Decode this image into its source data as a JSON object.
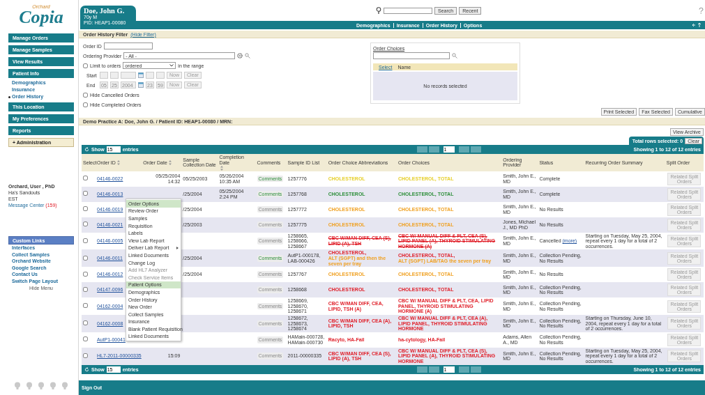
{
  "sidebar": {
    "logo": {
      "caption": "Orchard",
      "name": "Copia"
    },
    "nav": [
      {
        "label": "Manage Orders",
        "kind": "button"
      },
      {
        "label": "Manage Samples",
        "kind": "button"
      },
      {
        "label": "View Results",
        "kind": "button"
      },
      {
        "label": "Patient Info",
        "kind": "button",
        "children": [
          {
            "label": "Demographics",
            "selected": false
          },
          {
            "label": "Insurance",
            "selected": false
          },
          {
            "label": "Order History",
            "selected": true
          }
        ]
      },
      {
        "label": "This Location",
        "kind": "button"
      },
      {
        "label": "My Preferences",
        "kind": "button"
      },
      {
        "label": "Reports",
        "kind": "button"
      },
      {
        "label": "+ Administration",
        "kind": "admin"
      }
    ],
    "user": {
      "name": "Orchard, User , PhD",
      "location": "Ha's Sandouts",
      "timezone": "EST",
      "message_label": "Message Center",
      "message_count": "(159)"
    },
    "custom_links": {
      "title": "Custom Links",
      "items": [
        "Interfaces",
        "Collect Samples",
        "Orchard Website",
        "Google Search",
        "Contact Us",
        "Switch Page Layout"
      ],
      "hide": "Hide Menu"
    }
  },
  "patient": {
    "name": "Doe, John G.",
    "age_sex": "70y M",
    "pid": "PID: HEAP1-00080"
  },
  "search": {
    "search_button": "Search",
    "recent_button": "Recent"
  },
  "nav_links": [
    "Demographics",
    "Insurance",
    "Order History",
    "Options"
  ],
  "filter": {
    "title": "Order History Filter",
    "hide_link": "(Hide Filter)",
    "order_id_label": "Order ID",
    "provider_label": "Ordering Provider",
    "provider_value": "- All -",
    "limit": {
      "label": "Limit to orders",
      "checked": false,
      "value": "ordered",
      "suffix": "in the range"
    },
    "start": {
      "label": "Start",
      "now": "Now",
      "clear": "Clear"
    },
    "end": {
      "label": "End",
      "month": "05",
      "day": "25",
      "year": "2004",
      "hour": "23",
      "minute": "59",
      "now": "Now",
      "clear": "Clear"
    },
    "hide_options": [
      {
        "label": "Hide Cancelled Orders",
        "checked": false
      },
      {
        "label": "Hide Completed Orders",
        "checked": false
      }
    ]
  },
  "order_choices": {
    "title": "Order Choices",
    "columns": [
      "Select",
      "Name"
    ],
    "empty": "No records selected"
  },
  "actions": [
    "Print Selected",
    "Fax Selected",
    "Cumulative"
  ],
  "practice_bar": "Demo Practice A: Doe, John G. / Patient ID: HEAP1-00080 / MRN:",
  "view_archive": "View Archive",
  "selection": {
    "label": "Total rows selected: 0",
    "clear": "Clear"
  },
  "toolbars": [
    {
      "show": "Show",
      "entries_value": "15",
      "entries": "entries",
      "page": "1",
      "info": "Showing 1 to 12 of 12 entries"
    },
    {
      "show": "Show",
      "entries_value": "15",
      "entries": "entries",
      "page": "1",
      "info": "Showing 1 to 12 of 12 entries"
    }
  ],
  "columns": [
    {
      "label": "Select",
      "kind": "plain"
    },
    {
      "label": "Order ID",
      "kind": "sortable"
    },
    {
      "label": "Order Date",
      "kind": "sortable"
    },
    {
      "label": "Sample Collection Date",
      "kind": "plain"
    },
    {
      "label": "Completion Date",
      "kind": "sortable"
    },
    {
      "label": "Comments",
      "kind": "plain"
    },
    {
      "label": "Sample ID List",
      "kind": "plain"
    },
    {
      "label": "Order Choice Abbreviations",
      "kind": "plain"
    },
    {
      "label": "Order Choices",
      "kind": "plain"
    },
    {
      "label": "Ordering Provider",
      "kind": "plain"
    },
    {
      "label": "Status",
      "kind": "plain"
    },
    {
      "label": "Recurring Order Summary",
      "kind": "plain"
    },
    {
      "label": "Split Order",
      "kind": "plain"
    }
  ],
  "rows": [
    {
      "selected": false,
      "id": "04146-0022",
      "order_date": "05/25/2004 14:32",
      "collection_date": "05/25/2003",
      "completion_date": "05/26/2004 10:35 AM",
      "comments": {
        "label": "Comments",
        "has": true
      },
      "sample_ids": "1257776",
      "abbreviations": [
        {
          "text": "CHOLESTEROL",
          "color": "#e6cf2a",
          "struck": false
        }
      ],
      "choices": [
        {
          "text": "CHOLESTEROL, TOTAL",
          "color": "#e6cf2a",
          "struck": false
        }
      ],
      "provider": "Smith, John E., MD",
      "status": "Complete",
      "split": {
        "label": "Related Split Orders",
        "disabled": true
      }
    },
    {
      "selected": false,
      "id": "04146-0013",
      "collection_date": "/25/2004",
      "completion_date": "05/25/2004 2:24 PM",
      "comments": {
        "label": "Comments",
        "has": true
      },
      "sample_ids": "1257768",
      "abbreviations": [
        {
          "text": "CHOLESTEROL",
          "color": "#2e8f3a",
          "struck": false
        }
      ],
      "choices": [
        {
          "text": "CHOLESTEROL, TOTAL",
          "color": "#2e8f3a",
          "struck": false
        }
      ],
      "provider": "Smith, John E., MD",
      "status": "Complete",
      "split": {
        "label": "Related Split Orders",
        "disabled": true
      }
    },
    {
      "selected": false,
      "id": "04146-0019",
      "collection_date": "/25/2004",
      "comments": {
        "label": "Comments",
        "has": false
      },
      "sample_ids": "1257772",
      "abbreviations": [
        {
          "text": "CHOLESTEROL",
          "color": "#f0a020",
          "struck": false
        }
      ],
      "choices": [
        {
          "text": "CHOLESTEROL, TOTAL",
          "color": "#f0a020",
          "struck": false
        }
      ],
      "provider": "Smith, John E., MD",
      "status": "No Results",
      "split": {
        "label": "Related Split Orders",
        "disabled": true
      }
    },
    {
      "selected": false,
      "id": "04146-0021",
      "collection_date": "/25/2003",
      "comments": {
        "label": "Comments",
        "has": false
      },
      "sample_ids": "1257775",
      "abbreviations": [
        {
          "text": "CHOLESTEROL",
          "color": "#f0a020",
          "struck": false
        }
      ],
      "choices": [
        {
          "text": "CHOLESTEROL, TOTAL",
          "color": "#f0a020",
          "struck": false
        }
      ],
      "provider": "Jones, Michael J., MD PhD",
      "status": "No Results",
      "split": {
        "label": "Related Split Orders",
        "disabled": true
      }
    },
    {
      "selected": false,
      "id": "04146-0005",
      "comments": {
        "label": "Comments",
        "has": false
      },
      "sample_ids": "1258665, 1258666, 1258667",
      "abbreviations": [
        {
          "text": "CBC W/MAN DIFF, CEA (S), LIPID (A), TSH",
          "color": "#e0202a",
          "struck": true
        }
      ],
      "choices": [
        {
          "text": "CBC W/ MANUAL DIFF & PLT, CEA (S), LIPID PANEL (A), THYROID STIMULATING HORMONE (A)",
          "color": "#e0202a",
          "struck": true
        }
      ],
      "provider": "Smith, John E., MD",
      "status": "Cancelled",
      "status_link": "(more)",
      "recurring": "Starting on Tuesday, May 25, 2004, repeat every 1 day for a total of 2 occurrences.",
      "split": {
        "label": "Related Split Orders",
        "disabled": true
      }
    },
    {
      "selected": false,
      "id": "04146-0011",
      "collection_date": "/25/2004",
      "comments": {
        "label": "Comments",
        "has": true
      },
      "sample_ids": "AutP1-000178, LAB-000426",
      "abbreviations": [
        {
          "text": "CHOLESTEROL,",
          "color": "#e0202a",
          "struck": false
        },
        {
          "text": "ALT (SGPT) and then the seven per tray",
          "color": "#f0a020",
          "struck": false
        }
      ],
      "choices": [
        {
          "text": "CHOLESTEROL, TOTAL,",
          "color": "#e0202a",
          "struck": false
        },
        {
          "text": "ALT (SGPT) LAB/TAG the seven per tray",
          "color": "#f0a020",
          "struck": false
        }
      ],
      "provider": "Smith, John E., MD",
      "status": "Collection Pending, No Results",
      "split": {
        "label": "Related Split Orders",
        "disabled": true
      }
    },
    {
      "selected": false,
      "id": "04146-0012",
      "collection_date": "/25/2004",
      "comments": {
        "label": "Comments",
        "has": false
      },
      "sample_ids": "1257767",
      "abbreviations": [
        {
          "text": "CHOLESTEROL",
          "color": "#f0a020",
          "struck": false
        }
      ],
      "choices": [
        {
          "text": "CHOLESTEROL, TOTAL",
          "color": "#f0a020",
          "struck": false
        }
      ],
      "provider": "Smith, John E., MD",
      "status": "No Results",
      "split": {
        "label": "Related Split Orders",
        "disabled": true
      }
    },
    {
      "selected": false,
      "id": "04147-0096",
      "comments": {
        "label": "Comments",
        "has": false
      },
      "sample_ids": "1258668",
      "abbreviations": [
        {
          "text": "CHOLESTEROL",
          "color": "#e0202a",
          "struck": false
        }
      ],
      "choices": [
        {
          "text": "CHOLESTEROL, TOTAL",
          "color": "#e0202a",
          "struck": false
        }
      ],
      "provider": "Smith, John E., MD",
      "status": "Collection Pending, No Results",
      "split": {
        "label": "Related Split Orders",
        "disabled": true
      }
    },
    {
      "selected": false,
      "id": "04162-0004",
      "comments": {
        "label": "Comments",
        "has": false
      },
      "sample_ids": "1258669, 1258670, 1258671",
      "abbreviations": [
        {
          "text": "CBC W/MAN DIFF, CEA, LIPID, TSH (A)",
          "color": "#e0202a",
          "struck": false
        }
      ],
      "choices": [
        {
          "text": "CBC W/ MANUAL DIFF & PLT, CEA, LIPID PANEL, THYROID STIMULATING HORMONE (A)",
          "color": "#e0202a",
          "struck": false
        }
      ],
      "provider": "Smith, John E., MD",
      "status": "Collection Pending, No Results",
      "split": {
        "label": "Related Split Orders",
        "disabled": true
      }
    },
    {
      "selected": false,
      "id": "04162-0008",
      "comments": {
        "label": "Comments",
        "has": false
      },
      "sample_ids": "1258672, 1258673, 1258674",
      "abbreviations": [
        {
          "text": "CBC W/MAN DIFF, CEA (A), LIPID, TSH",
          "color": "#e0202a",
          "struck": false
        }
      ],
      "choices": [
        {
          "text": "CBC W/ MANUAL DIFF & PLT, CEA (A), LIPID PANEL, THYROID STIMULATING HORMONE",
          "color": "#e0202a",
          "struck": false
        }
      ],
      "provider": "Smith, John E., MD",
      "status": "Collection Pending, No Results",
      "recurring": "Starting on Thursday, June 10, 2004, repeat every 1 day for a total of 2 occurrences.",
      "split": {
        "label": "Related Split Orders",
        "disabled": true
      }
    },
    {
      "selected": false,
      "id": "AutP1-00041",
      "comments": {
        "label": "Comments",
        "has": false
      },
      "sample_ids": "HAMain-000728, HAMain-000730",
      "abbreviations": [
        {
          "text": "Racyto, HA-Fail",
          "color": "#e0202a",
          "struck": false
        }
      ],
      "choices": [
        {
          "text": "ha-cytology, HA-Fail",
          "color": "#e0202a",
          "struck": false
        }
      ],
      "provider": "Adams, Allen A., MD",
      "status": "Collection Pending, No Results",
      "split": {
        "label": "Related Split Orders",
        "disabled": true
      }
    },
    {
      "selected": false,
      "id": "HL7-2011-00000335",
      "order_date": "15:09",
      "comments": {
        "label": "Comments",
        "has": false
      },
      "sample_ids": "2011-00000335",
      "abbreviations": [
        {
          "text": "CBC W/MAN DIFF, CEA (S), LIPID (A), TSH",
          "color": "#e0202a",
          "struck": false
        }
      ],
      "choices": [
        {
          "text": "CBC W/ MANUAL DIFF & PLT, CEA (S), LIPID PANEL (A), THYROID STIMULATING HORMONE",
          "color": "#e0202a",
          "struck": false
        }
      ],
      "provider": "Smith, John E., MD",
      "status": "Collection Pending, No Results",
      "recurring": "Starting on Tuesday, May 25, 2004, repeat every 1 day for a total of 2 occurrences.",
      "split": {
        "label": "Related Split Orders",
        "disabled": true
      }
    }
  ],
  "context_menu": [
    {
      "label": "Order Options",
      "kind": "header"
    },
    {
      "label": "Review Order",
      "kind": "item"
    },
    {
      "label": "Samples",
      "kind": "item"
    },
    {
      "label": "Requisition",
      "kind": "item"
    },
    {
      "label": "Labels",
      "kind": "item"
    },
    {
      "label": "View Lab Report",
      "kind": "item"
    },
    {
      "label": "Deliver Lab Report",
      "kind": "submenu"
    },
    {
      "label": "Linked Documents",
      "kind": "item"
    },
    {
      "label": "Change Log",
      "kind": "item"
    },
    {
      "label": "Add HL7 Analyzer",
      "kind": "disabled"
    },
    {
      "label": "Check Service Items",
      "kind": "disabled"
    },
    {
      "label": "Patient Options",
      "kind": "header"
    },
    {
      "label": "Demographics",
      "kind": "item"
    },
    {
      "label": "Order History",
      "kind": "item"
    },
    {
      "label": "New Order",
      "kind": "item"
    },
    {
      "label": "Collect Samples",
      "kind": "item"
    },
    {
      "label": "Insurance",
      "kind": "item"
    },
    {
      "label": "Blank Patient Requisition",
      "kind": "item"
    },
    {
      "label": "Linked Documents",
      "kind": "item"
    }
  ],
  "sign_out": "Sign Out"
}
